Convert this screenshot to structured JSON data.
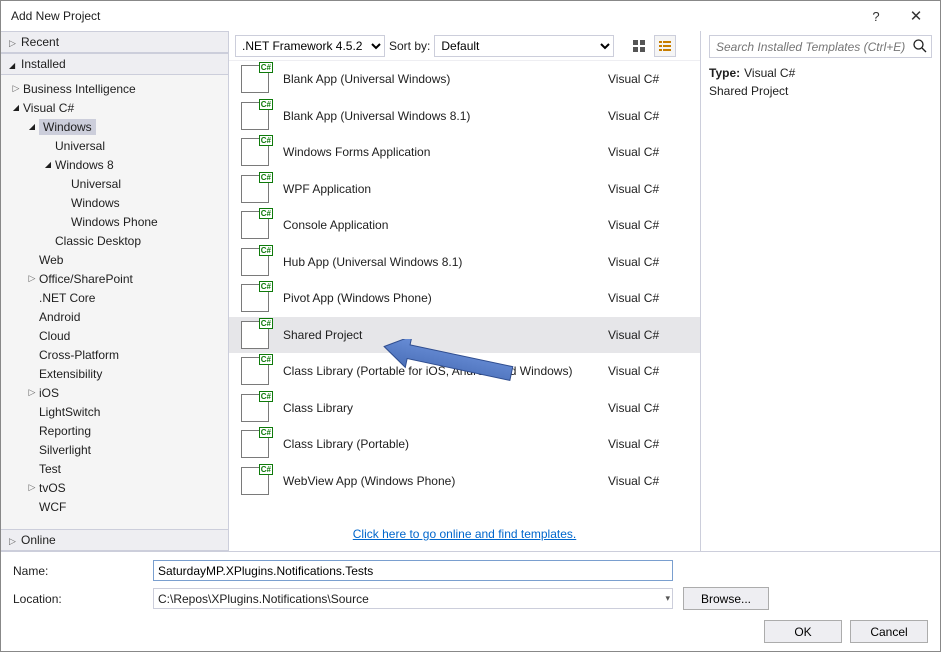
{
  "window": {
    "title": "Add New Project"
  },
  "left": {
    "recent": "Recent",
    "installed": "Installed",
    "online": "Online",
    "tree": [
      {
        "label": "Business Intelligence",
        "depth": 0,
        "expander": "closed"
      },
      {
        "label": "Visual C#",
        "depth": 0,
        "expander": "open"
      },
      {
        "label": "Windows",
        "depth": 1,
        "expander": "open",
        "selected": true
      },
      {
        "label": "Universal",
        "depth": 2,
        "expander": "none"
      },
      {
        "label": "Windows 8",
        "depth": 2,
        "expander": "open"
      },
      {
        "label": "Universal",
        "depth": 3,
        "expander": "none"
      },
      {
        "label": "Windows",
        "depth": 3,
        "expander": "none"
      },
      {
        "label": "Windows Phone",
        "depth": 3,
        "expander": "none"
      },
      {
        "label": "Classic Desktop",
        "depth": 2,
        "expander": "none"
      },
      {
        "label": "Web",
        "depth": 1,
        "expander": "none"
      },
      {
        "label": "Office/SharePoint",
        "depth": 1,
        "expander": "closed"
      },
      {
        "label": ".NET Core",
        "depth": 1,
        "expander": "none"
      },
      {
        "label": "Android",
        "depth": 1,
        "expander": "none"
      },
      {
        "label": "Cloud",
        "depth": 1,
        "expander": "none"
      },
      {
        "label": "Cross-Platform",
        "depth": 1,
        "expander": "none"
      },
      {
        "label": "Extensibility",
        "depth": 1,
        "expander": "none"
      },
      {
        "label": "iOS",
        "depth": 1,
        "expander": "closed"
      },
      {
        "label": "LightSwitch",
        "depth": 1,
        "expander": "none"
      },
      {
        "label": "Reporting",
        "depth": 1,
        "expander": "none"
      },
      {
        "label": "Silverlight",
        "depth": 1,
        "expander": "none"
      },
      {
        "label": "Test",
        "depth": 1,
        "expander": "none"
      },
      {
        "label": "tvOS",
        "depth": 1,
        "expander": "closed"
      },
      {
        "label": "WCF",
        "depth": 1,
        "expander": "none"
      }
    ]
  },
  "toolbar": {
    "framework": ".NET Framework 4.5.2",
    "sortby_label": "Sort by:",
    "sortby_value": "Default"
  },
  "templates": [
    {
      "name": "Blank App (Universal Windows)",
      "lang": "Visual C#"
    },
    {
      "name": "Blank App (Universal Windows 8.1)",
      "lang": "Visual C#"
    },
    {
      "name": "Windows Forms Application",
      "lang": "Visual C#"
    },
    {
      "name": "WPF Application",
      "lang": "Visual C#"
    },
    {
      "name": "Console Application",
      "lang": "Visual C#"
    },
    {
      "name": "Hub App (Universal Windows 8.1)",
      "lang": "Visual C#"
    },
    {
      "name": "Pivot App (Windows Phone)",
      "lang": "Visual C#"
    },
    {
      "name": "Shared Project",
      "lang": "Visual C#",
      "selected": true
    },
    {
      "name": "Class Library (Portable for iOS, Android and Windows)",
      "lang": "Visual C#"
    },
    {
      "name": "Class Library",
      "lang": "Visual C#"
    },
    {
      "name": "Class Library (Portable)",
      "lang": "Visual C#"
    },
    {
      "name": "WebView App (Windows Phone)",
      "lang": "Visual C#"
    }
  ],
  "online_link": "Click here to go online and find templates.",
  "search": {
    "placeholder": "Search Installed Templates (Ctrl+E)"
  },
  "details": {
    "type_label": "Type:",
    "type_value": "Visual C#",
    "desc": "Shared Project"
  },
  "form": {
    "name_label": "Name:",
    "name_value": "SaturdayMP.XPlugins.Notifications.Tests",
    "location_label": "Location:",
    "location_value": "C:\\Repos\\XPlugins.Notifications\\Source",
    "browse": "Browse...",
    "ok": "OK",
    "cancel": "Cancel"
  }
}
